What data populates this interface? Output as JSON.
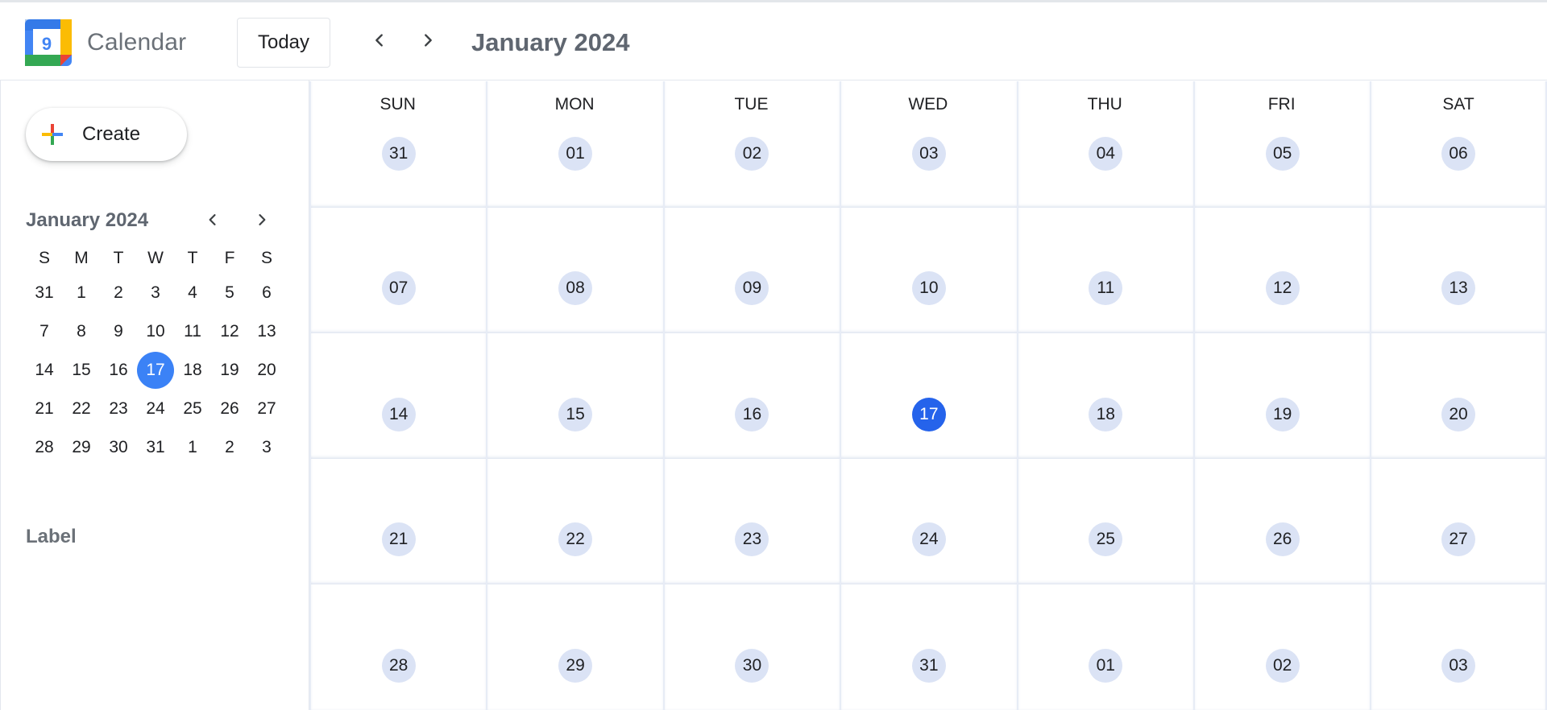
{
  "app": {
    "name": "Calendar",
    "logo_day": "9"
  },
  "header": {
    "today_label": "Today",
    "title": "January 2024"
  },
  "sidebar": {
    "create_label": "Create",
    "mini_title": "January 2024",
    "weekday_initials": [
      "S",
      "M",
      "T",
      "W",
      "T",
      "F",
      "S"
    ],
    "weeks": [
      [
        "31",
        "1",
        "2",
        "3",
        "4",
        "5",
        "6"
      ],
      [
        "7",
        "8",
        "9",
        "10",
        "11",
        "12",
        "13"
      ],
      [
        "14",
        "15",
        "16",
        "17",
        "18",
        "19",
        "20"
      ],
      [
        "21",
        "22",
        "23",
        "24",
        "25",
        "26",
        "27"
      ],
      [
        "28",
        "29",
        "30",
        "31",
        "1",
        "2",
        "3"
      ]
    ],
    "selected_day": "17",
    "label_heading": "Label"
  },
  "month": {
    "day_headers": [
      "SUN",
      "MON",
      "TUE",
      "WED",
      "THU",
      "FRI",
      "SAT"
    ],
    "weeks": [
      [
        "31",
        "01",
        "02",
        "03",
        "04",
        "05",
        "06"
      ],
      [
        "07",
        "08",
        "09",
        "10",
        "11",
        "12",
        "13"
      ],
      [
        "14",
        "15",
        "16",
        "17",
        "18",
        "19",
        "20"
      ],
      [
        "21",
        "22",
        "23",
        "24",
        "25",
        "26",
        "27"
      ],
      [
        "28",
        "29",
        "30",
        "31",
        "01",
        "02",
        "03"
      ]
    ],
    "today": "17"
  },
  "colors": {
    "accent": "#2563eb",
    "mini_selected": "#3b82f6",
    "day_chip": "#dbe3f5"
  }
}
